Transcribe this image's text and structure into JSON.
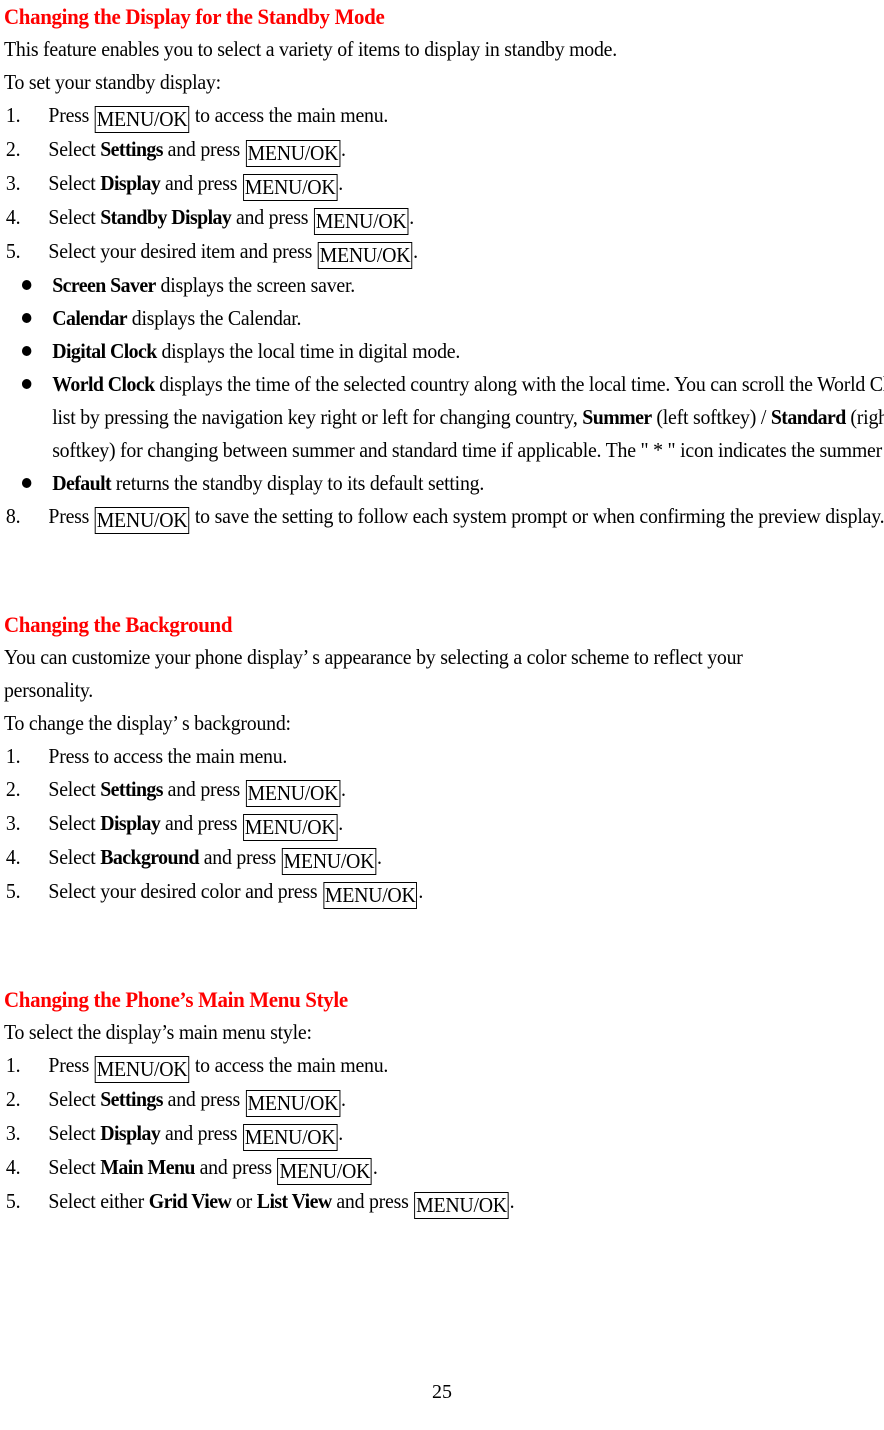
{
  "page": {
    "number": "25",
    "heading_color": "#ff0000",
    "body_color": "#000000"
  },
  "key_label": "MENU/OK",
  "sections": [
    {
      "heading": "Changing the Display for the Standby Mode",
      "intro": "This feature enables you to select a variety of items to display in standby mode.",
      "lead_in": "To set your standby display:",
      "steps": [
        {
          "num": "1.",
          "pre": "Press ",
          "key": "MENU/OK",
          "post": " to access the main menu."
        },
        {
          "num": "2.",
          "pre": "Select ",
          "bold": "Settings",
          "mid": " and press ",
          "key": "MENU/OK",
          "post": "."
        },
        {
          "num": "3.",
          "pre": "Select ",
          "bold": "Display",
          "mid": " and press ",
          "key": "MENU/OK",
          "post": "."
        },
        {
          "num": "4.",
          "pre": "Select ",
          "bold": "Standby Display",
          "mid": " and press ",
          "key": "MENU/OK",
          "post": "."
        },
        {
          "num": "5.",
          "pre": "Select your desired item and press ",
          "key": "MENU/OK",
          "post": "."
        }
      ],
      "bullets": [
        {
          "bold": "Screen Saver",
          "text": " displays the screen saver."
        },
        {
          "bold": "Calendar",
          "text": " displays the Calendar."
        },
        {
          "bold": "Digital Clock",
          "text": " displays the local time in digital mode."
        },
        {
          "bold": "World Clock",
          "text": " displays the time of the selected country along with the local time. You can scroll the World Clock list by pressing the navigation key right or left for changing country, ",
          "bold2": "Summer",
          "text2": " (left softkey) / ",
          "bold3": "Standard",
          "text3": " (right softkey) for changing between summer and standard time if applicable. The \" * \" icon indicates the summer time."
        },
        {
          "bold": "Default",
          "text": " returns the standby display to its default setting."
        }
      ],
      "final_step": {
        "num": "8.",
        "pre": "Press ",
        "key": "MENU/OK",
        "post": " to save the setting to follow each system prompt or when confirming the preview display."
      }
    },
    {
      "heading": "Changing the Background",
      "intro_line1": "You can customize your phone display’ s appearance by selecting a color scheme to reflect your",
      "intro_line2": "personality.",
      "lead_in": "To change the display’ s background:",
      "steps": [
        {
          "num": "1.",
          "pre": "Press to access the main menu."
        },
        {
          "num": "2.",
          "pre": "Select ",
          "bold": "Settings",
          "mid": " and press ",
          "key": "MENU/OK",
          "post": "."
        },
        {
          "num": "3.",
          "pre": "Select ",
          "bold": "Display",
          "mid": " and press ",
          "key": "MENU/OK",
          "post": "."
        },
        {
          "num": "4.",
          "pre": "Select ",
          "bold": "Background",
          "mid": " and press ",
          "key": "MENU/OK",
          "post": "."
        },
        {
          "num": "5.",
          "pre": "Select your desired color and press ",
          "key": "MENU/OK",
          "post": "."
        }
      ]
    },
    {
      "heading": "Changing the Phone’s Main Menu Style",
      "lead_in": "To select the display’s main menu style:",
      "steps": [
        {
          "num": "1.",
          "pre": "Press ",
          "key": "MENU/OK",
          "post": " to access the main menu."
        },
        {
          "num": "2.",
          "pre": "Select ",
          "bold": "Settings",
          "mid": " and press ",
          "key": "MENU/OK",
          "post": "."
        },
        {
          "num": "3.",
          "pre": "Select ",
          "bold": "Display",
          "mid": " and press ",
          "key": "MENU/OK",
          "post": "."
        },
        {
          "num": "4.",
          "pre": "Select ",
          "bold": "Main Menu",
          "mid": " and press ",
          "key": "MENU/OK",
          "post": "."
        },
        {
          "num": "5.",
          "pre": "Select either ",
          "bold": "Grid View",
          "mid": " or ",
          "bold2": "List View",
          "mid2": " and press ",
          "key": "MENU/OK",
          "post": "."
        }
      ]
    }
  ]
}
